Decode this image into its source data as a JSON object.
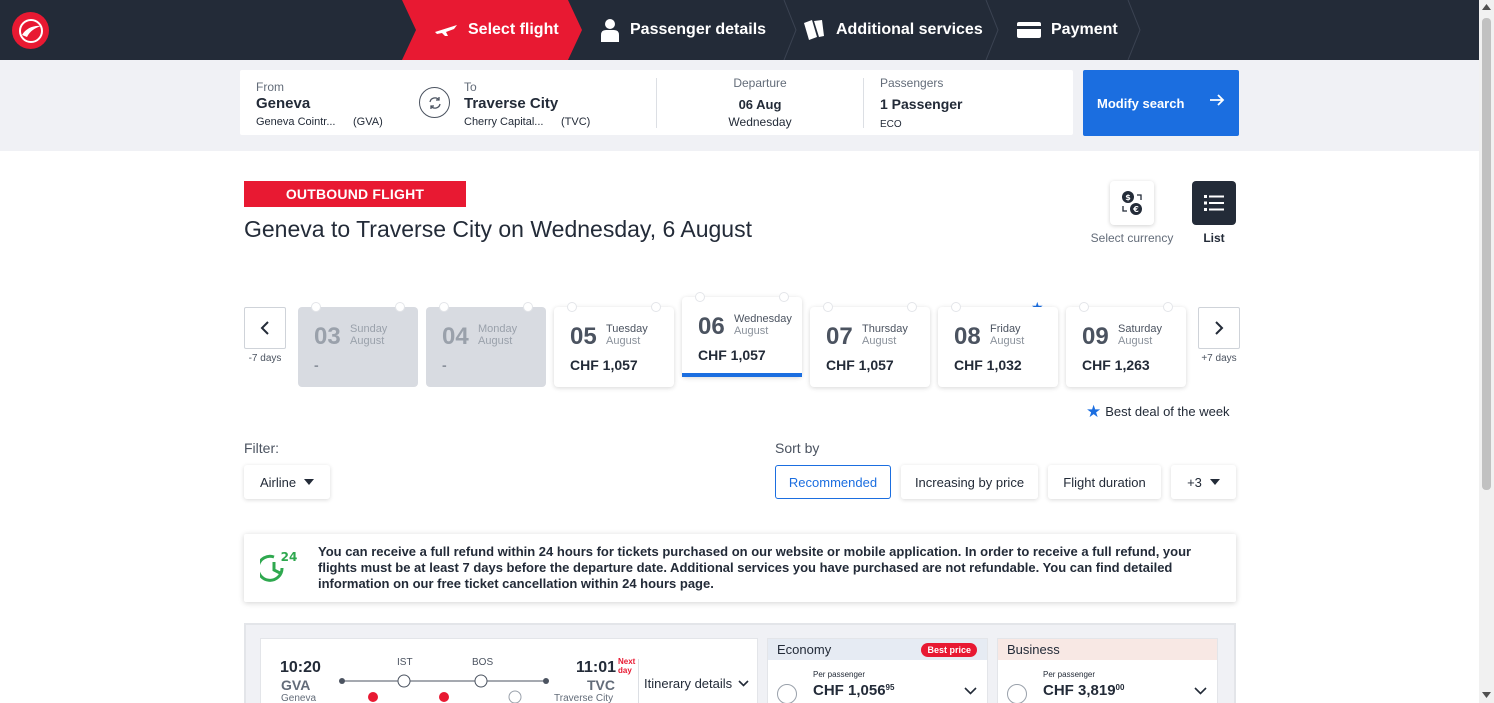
{
  "nav": {
    "steps": [
      {
        "label": "Select flight",
        "icon": "plane-icon",
        "active": true
      },
      {
        "label": "Passenger details",
        "icon": "person-icon",
        "active": false
      },
      {
        "label": "Additional services",
        "icon": "tickets-icon",
        "active": false
      },
      {
        "label": "Payment",
        "icon": "card-icon",
        "active": false
      }
    ]
  },
  "search": {
    "from_label": "From",
    "from_city": "Geneva",
    "from_airport": "Geneva Cointr...",
    "from_code": "(GVA)",
    "to_label": "To",
    "to_city": "Traverse City",
    "to_airport": "Cherry Capital...",
    "to_code": "(TVC)",
    "departure_label": "Departure",
    "departure_date": "06 Aug",
    "departure_day": "Wednesday",
    "passengers_label": "Passengers",
    "passengers_value": "1 Passenger",
    "cabin_class": "ECO",
    "modify_label": "Modify search"
  },
  "header": {
    "badge": "OUTBOUND FLIGHT",
    "title": "Geneva to Traverse City on Wednesday, 6 August",
    "currency_label": "Select currency",
    "list_label": "List"
  },
  "dates": {
    "prev_label": "-7 days",
    "next_label": "+7 days",
    "best_deal_label": "Best deal of the week",
    "items": [
      {
        "num": "03",
        "dow": "Sunday",
        "month": "August",
        "price": "-",
        "state": "disabled"
      },
      {
        "num": "04",
        "dow": "Monday",
        "month": "August",
        "price": "-",
        "state": "disabled"
      },
      {
        "num": "05",
        "dow": "Tuesday",
        "month": "August",
        "price": "CHF 1,057",
        "state": "normal"
      },
      {
        "num": "06",
        "dow": "Wednesday",
        "month": "August",
        "price": "CHF 1,057",
        "state": "selected"
      },
      {
        "num": "07",
        "dow": "Thursday",
        "month": "August",
        "price": "CHF 1,057",
        "state": "normal"
      },
      {
        "num": "08",
        "dow": "Friday",
        "month": "August",
        "price": "CHF 1,032",
        "state": "best"
      },
      {
        "num": "09",
        "dow": "Saturday",
        "month": "August",
        "price": "CHF 1,263",
        "state": "normal"
      }
    ]
  },
  "filter": {
    "label": "Filter:",
    "airline": "Airline"
  },
  "sort": {
    "label": "Sort by",
    "options": [
      "Recommended",
      "Increasing by price",
      "Flight duration",
      "+3"
    ],
    "selected": "Recommended"
  },
  "notice": {
    "badge": "24",
    "text": "You can receive a full refund within 24 hours for tickets purchased on our website or mobile application. In order to receive a full refund, your flights must be at least 7 days before the departure date. Additional services you have purchased are not refundable. You can find detailed information on our free ticket cancellation within 24 hours page."
  },
  "flight": {
    "dep_time": "10:20",
    "dep_code": "GVA",
    "dep_city": "Geneva",
    "arr_time": "11:01",
    "arr_code": "TVC",
    "arr_city": "Traverse City",
    "next_day": "Next day",
    "stops": [
      "IST",
      "BOS"
    ],
    "itinerary_label": "Itinerary details",
    "economy": {
      "label": "Economy",
      "badge": "Best price",
      "per_passenger": "Per passenger",
      "price": "CHF 1,056",
      "cents": "95"
    },
    "business": {
      "label": "Business",
      "per_passenger": "Per passenger",
      "price": "CHF 3,819",
      "cents": "00"
    }
  },
  "colors": {
    "brand_red": "#e81932",
    "nav_dark": "#232b38",
    "accent_blue": "#1b6ee0"
  }
}
